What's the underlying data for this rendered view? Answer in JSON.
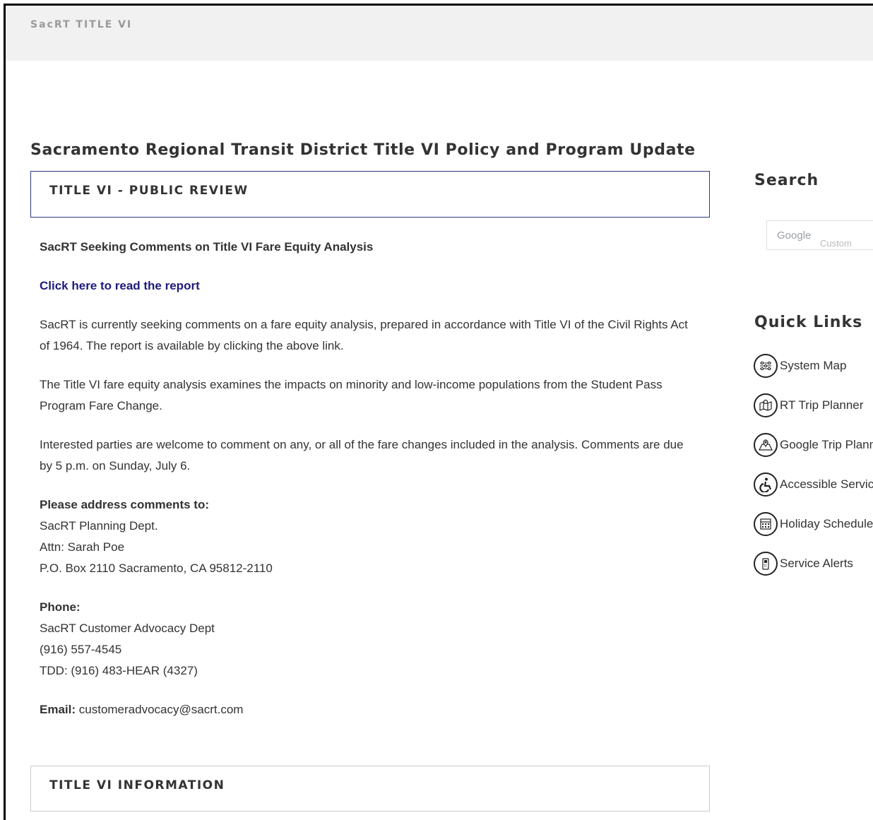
{
  "header": {
    "brand": "SacRT TITLE VI"
  },
  "page_title": "Sacramento Regional Transit District Title VI Policy and Program Update",
  "review_panel": {
    "heading": "TITLE VI - PUBLIC REVIEW"
  },
  "content": {
    "subheading": "SacRT Seeking Comments on Title VI Fare Equity Analysis",
    "report_link": "Click here to read the report",
    "para1": "SacRT is currently seeking comments on a fare equity analysis, prepared in accordance with Title VI of the Civil Rights Act of 1964. The report is available by clicking the above link.",
    "para2": "The Title VI fare equity analysis examines the impacts on minority and low-income populations from the Student Pass Program Fare Change.",
    "para3": "Interested parties are welcome to comment on any, or all of the fare changes included in the analysis. Comments are due by 5 p.m. on Sunday, July 6.",
    "address_label": "Please address comments to:",
    "address_lines": [
      "SacRT Planning Dept.",
      "Attn: Sarah Poe",
      "P.O. Box 2110 Sacramento, CA 95812-2110"
    ],
    "phone_label": "Phone:",
    "phone_lines": [
      "SacRT Customer Advocacy Dept",
      "(916) 557-4545",
      "TDD: (916) 483-HEAR (4327)"
    ],
    "email_label": "Email:",
    "email_value": "customeradvocacy@sacrt.com"
  },
  "info_panel": {
    "heading": "TITLE VI INFORMATION"
  },
  "sidebar": {
    "search_heading": "Search",
    "search_placeholder": "Google",
    "search_watermark": "Custom Search",
    "quick_links_heading": "Quick Links",
    "quick_links": [
      {
        "label": "System Map",
        "icon": "system-map-icon"
      },
      {
        "label": "RT Trip Planner",
        "icon": "trip-planner-icon"
      },
      {
        "label": "Google Trip Planner",
        "icon": "map-pin-icon"
      },
      {
        "label": "Accessible Services",
        "icon": "wheelchair-icon"
      },
      {
        "label": "Holiday Schedule",
        "icon": "calendar-icon"
      },
      {
        "label": "Service Alerts",
        "icon": "phone-icon"
      }
    ]
  }
}
